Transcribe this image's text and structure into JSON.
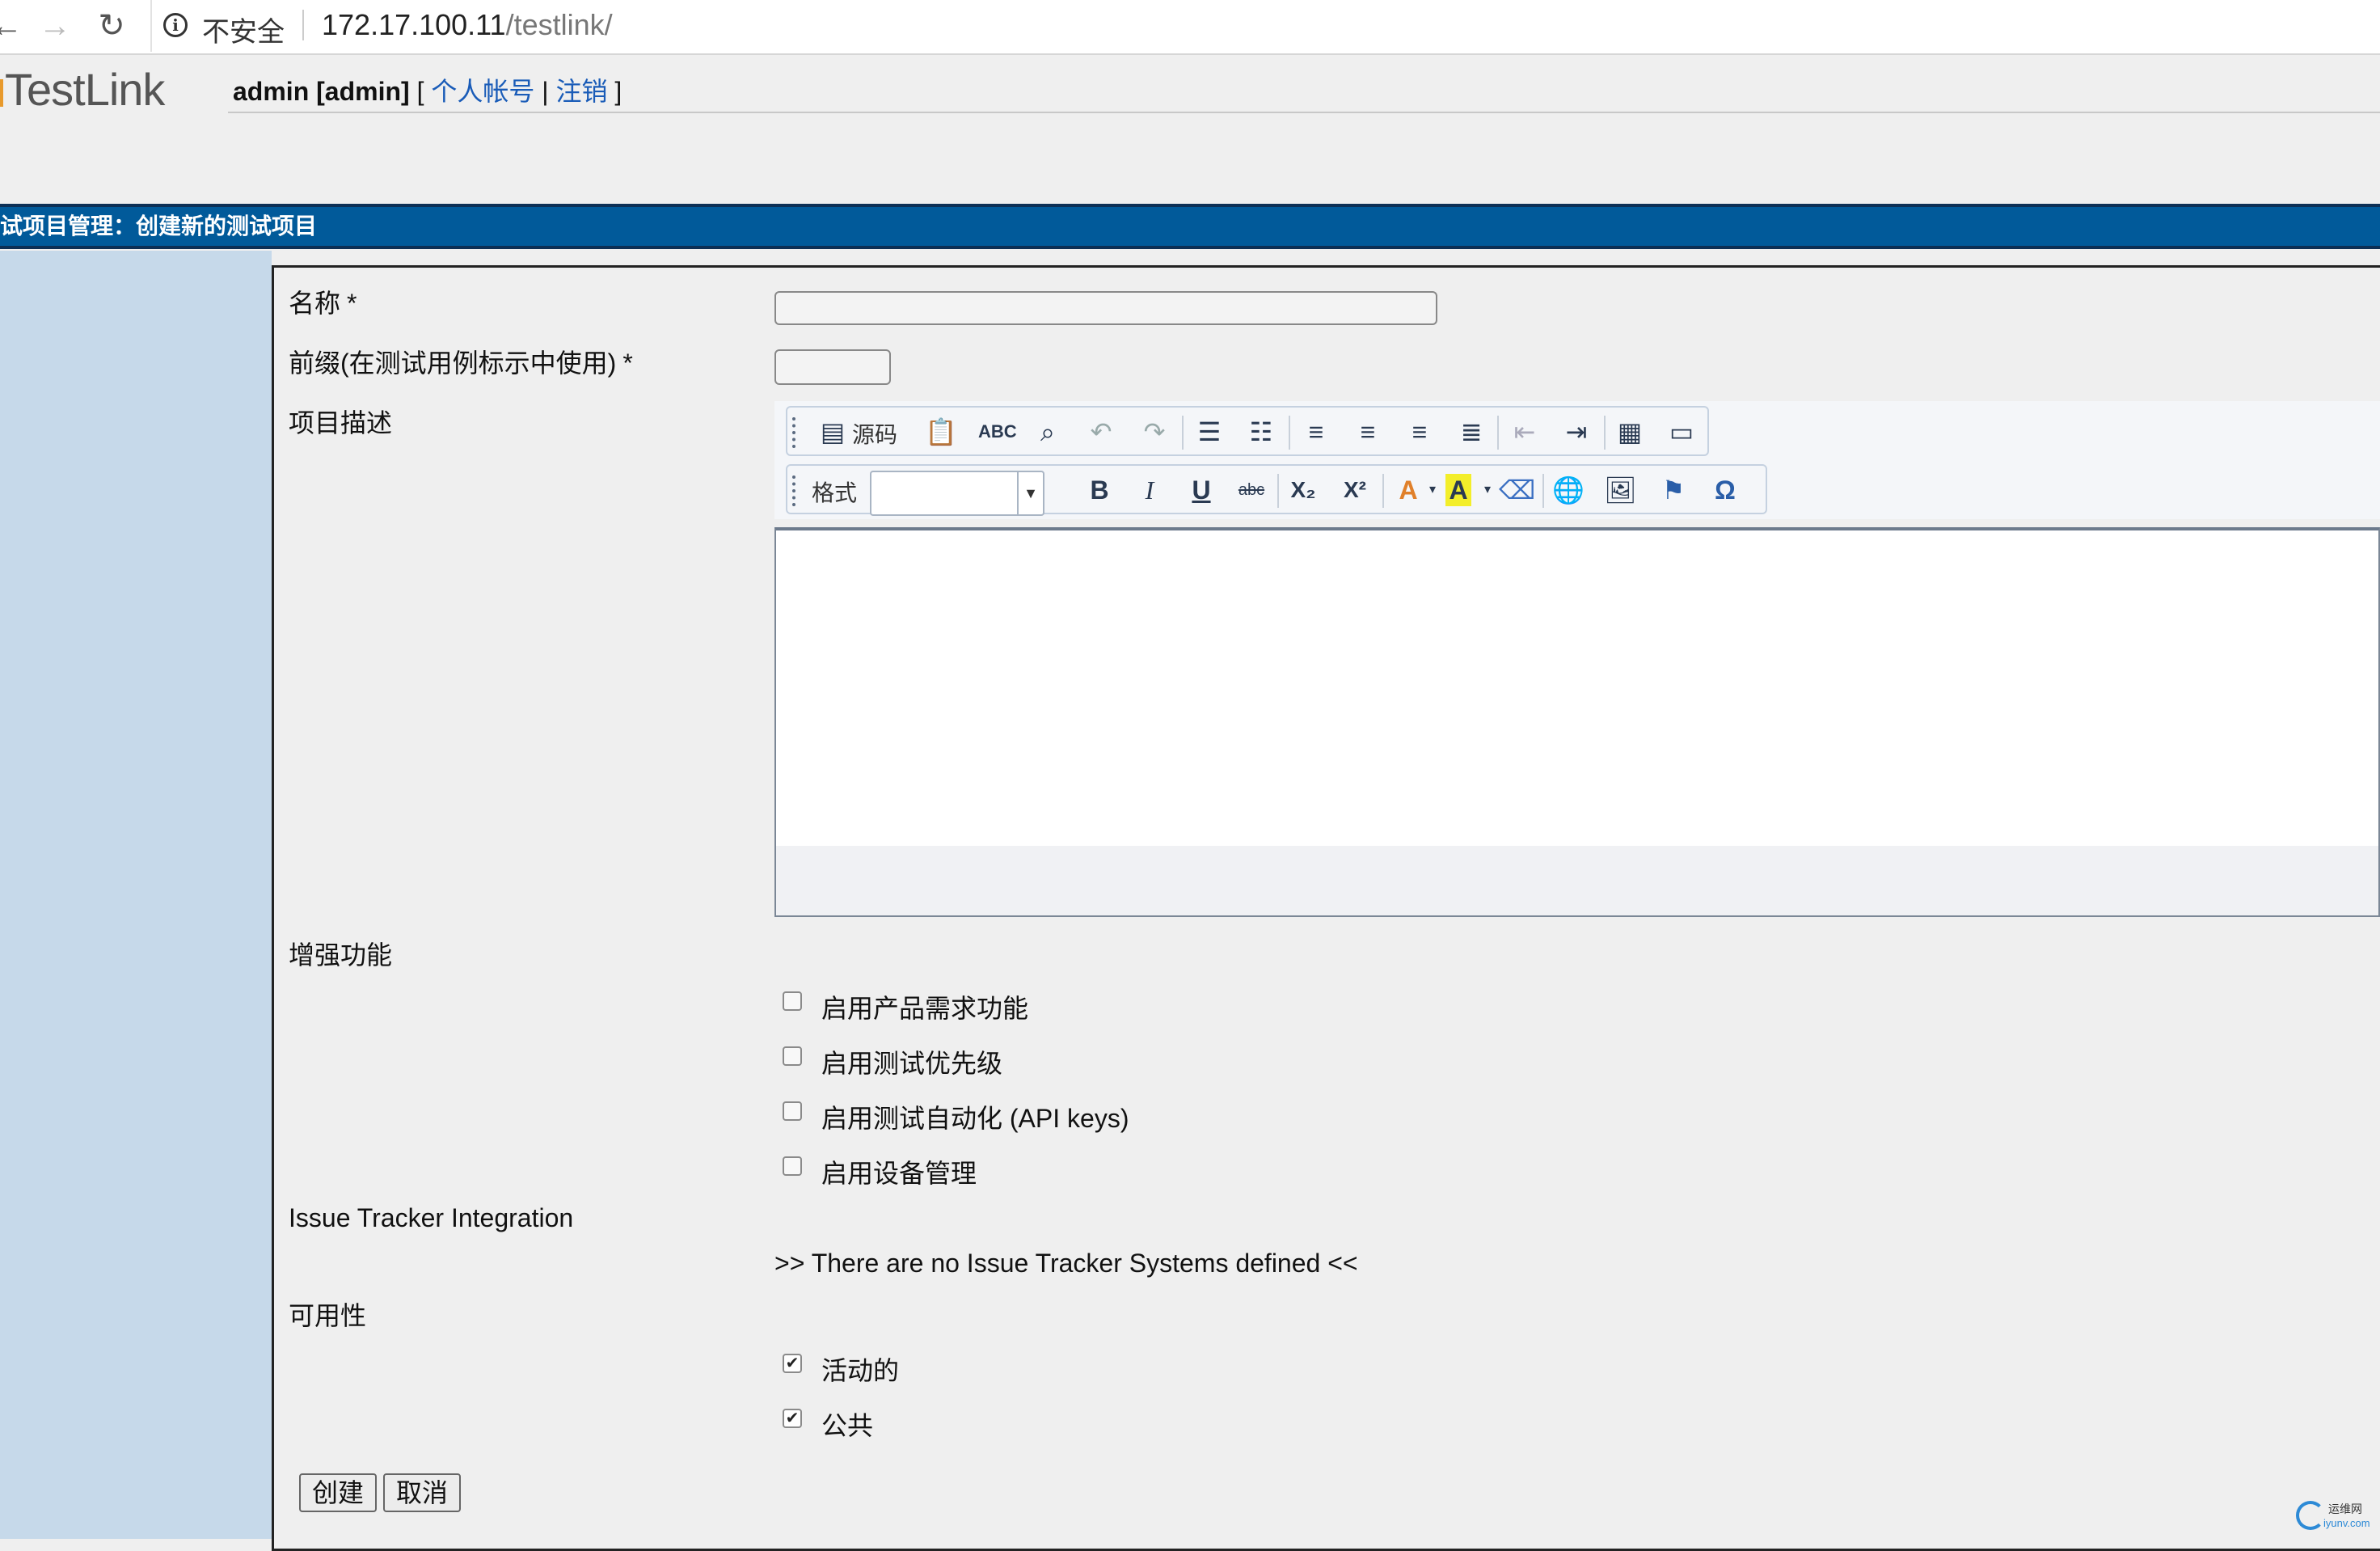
{
  "browser": {
    "security_label": "不安全",
    "url_host": "172.17.100.11",
    "url_path": "/testlink/"
  },
  "header": {
    "logo_text": "TestLink",
    "user": "admin [admin]",
    "bracket_open": "[",
    "account_link": "个人帐号",
    "divider": "|",
    "logout_link": "注销",
    "bracket_close": "]"
  },
  "title": "试项目管理：创建新的测试项目",
  "form": {
    "name_label": "名称",
    "prefix_label": "前缀(在测试用例标示中使用)",
    "required_mark": "*",
    "name_value": "",
    "prefix_value": "",
    "description_label": "项目描述",
    "editor": {
      "source_label": "源码",
      "format_label": "格式",
      "format_value": "",
      "bold": "B",
      "italic": "I",
      "underline": "U",
      "strike": "abc",
      "subscript": "X₂",
      "superscript": "X²",
      "text_color": "A",
      "bg_color": "A",
      "special_char": "Ω"
    },
    "enhancements_label": "增强功能",
    "options": [
      {
        "label": "启用产品需求功能",
        "checked": false
      },
      {
        "label": "启用测试优先级",
        "checked": false
      },
      {
        "label": "启用测试自动化 (API keys)",
        "checked": false
      },
      {
        "label": "启用设备管理",
        "checked": false
      }
    ],
    "tracker_label": "Issue Tracker Integration",
    "tracker_message": ">> There are no Issue Tracker Systems defined <<",
    "availability_label": "可用性",
    "availability": [
      {
        "label": "活动的",
        "checked": true
      },
      {
        "label": "公共",
        "checked": true
      }
    ],
    "create_button": "创建",
    "cancel_button": "取消"
  },
  "watermark": {
    "line1": "运维网",
    "line2": "iyunv.com"
  },
  "colors": {
    "title_bar": "#015a9a",
    "left_pane": "#c6d9ea",
    "link": "#1a5cb8"
  }
}
